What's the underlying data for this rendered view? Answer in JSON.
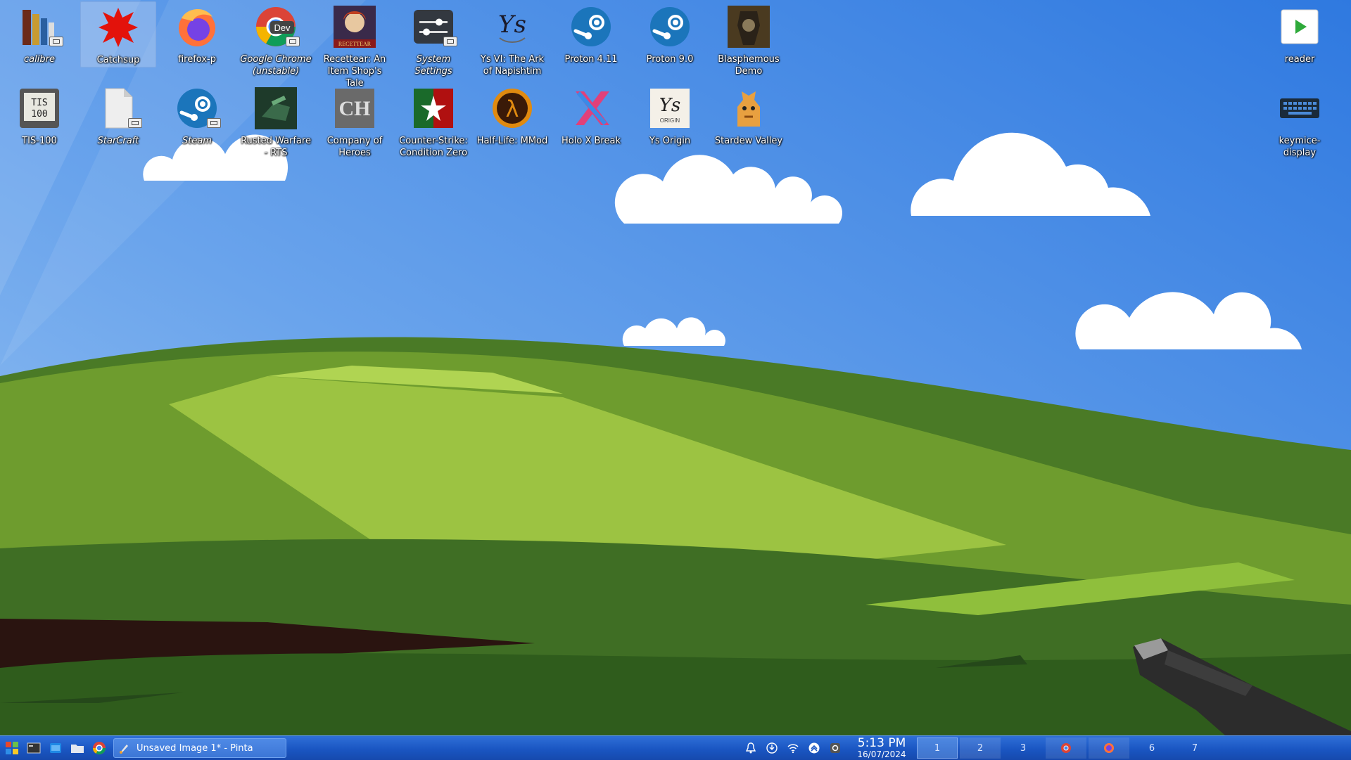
{
  "desktop_icons": [
    {
      "label": "calibre",
      "icon": "calibre-icon",
      "italic": true,
      "shortcut": true
    },
    {
      "label": "Catchsup",
      "icon": "catchsup-icon",
      "selected": true
    },
    {
      "label": "firefox-p",
      "icon": "firefox-icon"
    },
    {
      "label": "Google Chrome (unstable)",
      "icon": "chrome-dev-icon",
      "italic": true,
      "shortcut": true
    },
    {
      "label": "Recettear: An Item Shop's Tale",
      "icon": "recettear-icon"
    },
    {
      "label": "System Settings",
      "icon": "system-settings-icon",
      "italic": true,
      "shortcut": true
    },
    {
      "label": "Ys VI: The Ark of Napishtim",
      "icon": "ys-vi-icon"
    },
    {
      "label": "Proton 4.11",
      "icon": "steam-icon"
    },
    {
      "label": "Proton 9.0",
      "icon": "steam-icon"
    },
    {
      "label": "Blasphemous Demo",
      "icon": "blasphemous-icon"
    },
    {
      "label": "reader",
      "icon": "reader-play-icon"
    },
    {
      "label": "TIS-100",
      "icon": "tis-100-icon"
    },
    {
      "label": "StarCraft",
      "icon": "file-icon",
      "italic": true,
      "shortcut": true
    },
    {
      "label": "Steam",
      "icon": "steam-icon",
      "italic": true,
      "shortcut": true
    },
    {
      "label": "Rusted Warfare - RTS",
      "icon": "rusted-warfare-icon"
    },
    {
      "label": "Company of Heroes",
      "icon": "company-of-heroes-icon"
    },
    {
      "label": "Counter-Strike: Condition Zero",
      "icon": "counter-strike-icon"
    },
    {
      "label": "Half-Life: MMod",
      "icon": "half-life-icon"
    },
    {
      "label": "Holo X Break",
      "icon": "holo-x-break-icon"
    },
    {
      "label": "Ys Origin",
      "icon": "ys-origin-icon"
    },
    {
      "label": "Stardew Valley",
      "icon": "stardew-valley-icon"
    },
    {
      "label": "keymice-display",
      "icon": "keyboard-icon"
    }
  ],
  "icon_text": {
    "tis_top": "TIS",
    "tis_bottom": "100",
    "chrome_dev": "Dev",
    "coh": "CH",
    "ys_origin": "ORIGIN",
    "recettear": "RECETTEAR"
  },
  "taskbar": {
    "launchers": [
      "start-menu-icon",
      "show-desktop-icon",
      "outlook-icon",
      "file-manager-icon",
      "chrome-icon"
    ],
    "task_label": "Unsaved Image 1* - Pinta",
    "tray": [
      "notifications-icon",
      "update-icon",
      "wifi-icon",
      "expand-tray-icon",
      "settings-tray-icon"
    ],
    "time": "5:13 PM",
    "date": "16/07/2024",
    "desktops": [
      "1",
      "2",
      "3",
      "",
      "",
      "6",
      "7"
    ]
  },
  "colors": {
    "sky_top": "#3d86e8",
    "grass_light": "#9cc342",
    "grass_dark": "#4a7a26",
    "taskbar": "#1a56c2"
  }
}
